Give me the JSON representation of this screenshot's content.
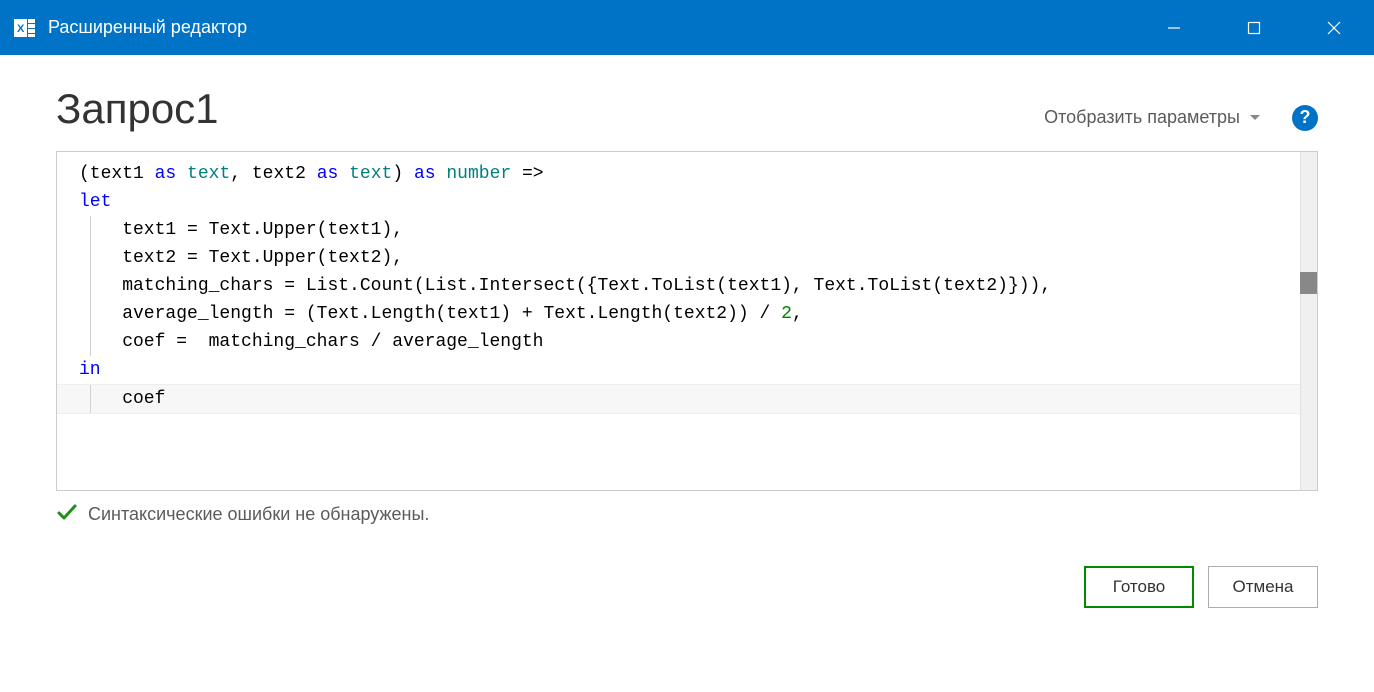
{
  "titlebar": {
    "title": "Расширенный редактор"
  },
  "header": {
    "query_name": "Запрос1",
    "display_params_label": "Отобразить параметры"
  },
  "code": {
    "sig_open": "(text1 ",
    "sig_as1": "as",
    "sig_sp1": " ",
    "sig_text1": "text",
    "sig_comma": ", text2 ",
    "sig_as2": "as",
    "sig_sp2": " ",
    "sig_text2": "text",
    "sig_close": ") ",
    "sig_as3": "as",
    "sig_sp3": " ",
    "sig_number": "number",
    "sig_arrow": " =>",
    "let_kw": "let",
    "l3": "    text1 = Text.Upper(text1),",
    "l4": "    text2 = Text.Upper(text2),",
    "l5": "    matching_chars = List.Count(List.Intersect({Text.ToList(text1), Text.ToList(text2)})),",
    "l6_a": "    average_length = (Text.Length(text1) + Text.Length(text2)) / ",
    "l6_num": "2",
    "l6_b": ",",
    "l7": "    coef =  matching_chars / average_length",
    "in_kw": "in",
    "l9": "    coef"
  },
  "status": {
    "message": "Синтаксические ошибки не обнаружены."
  },
  "buttons": {
    "ok": "Готово",
    "cancel": "Отмена"
  }
}
